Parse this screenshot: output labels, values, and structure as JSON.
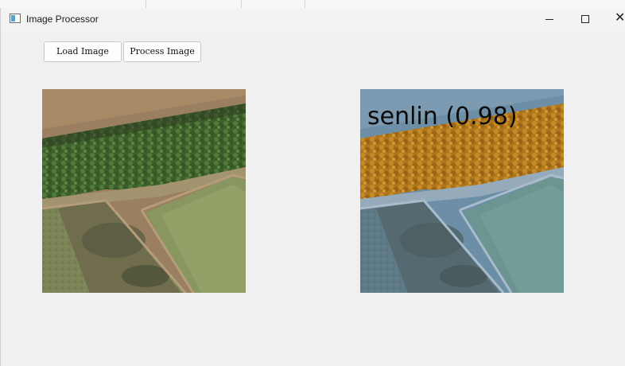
{
  "window": {
    "title": "Image Processor"
  },
  "toolbar": {
    "load_label": "Load Image",
    "process_label": "Process Image"
  },
  "output": {
    "detection_label": "senlin",
    "confidence": "(0.98)"
  },
  "icons": {
    "app": "window-app-icon",
    "minimize": "minimize-icon",
    "maximize": "maximize-icon",
    "close": "close-icon"
  },
  "colors": {
    "overlay_orange": "#c07a18",
    "overlay_blue": "#4c6f86"
  }
}
